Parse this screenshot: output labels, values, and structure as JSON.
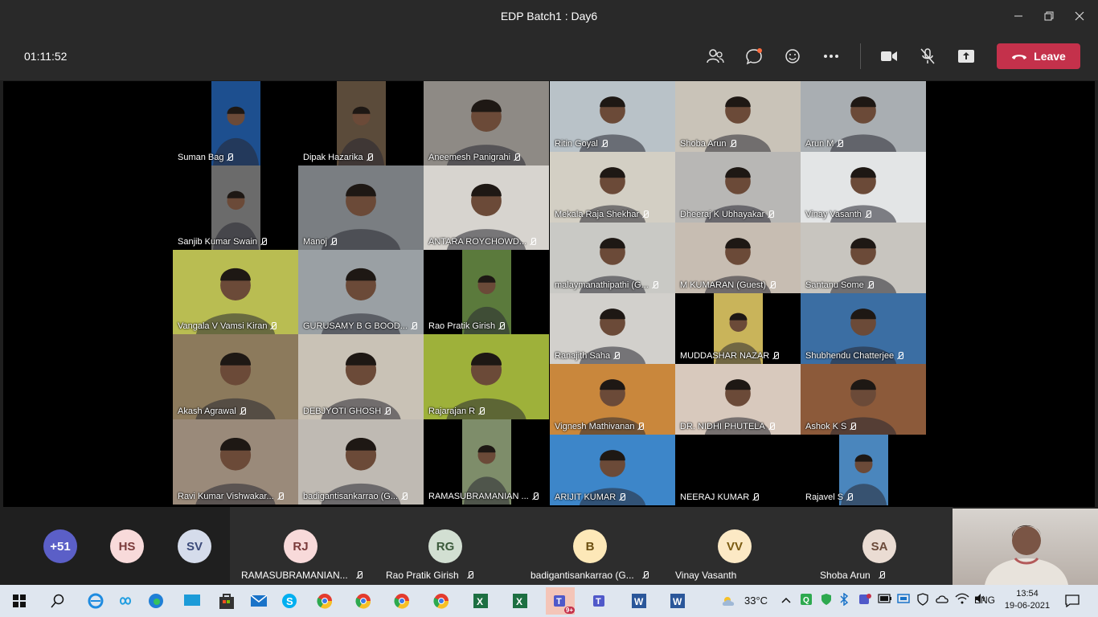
{
  "window": {
    "title": "EDP Batch1 : Day6"
  },
  "toolbar": {
    "timer": "01:11:52",
    "leave_label": "Leave"
  },
  "tiles": [
    {
      "name": "Suman Bag",
      "bg": "#1d4f8f"
    },
    {
      "name": "Dipak Hazarika",
      "bg": "#5b4b3a"
    },
    {
      "name": "Aneemesh Panigrahi",
      "bg": "#8e8a85"
    },
    {
      "name": "Ritin Goyal",
      "bg": "#b9c2c8"
    },
    {
      "name": "Shoba Arun",
      "bg": "#c9c3b8"
    },
    {
      "name": "Arun M",
      "bg": "#a9aeb2"
    },
    {
      "name": "Sanjib Kumar Swain",
      "bg": "#6b6b6b"
    },
    {
      "name": "Manoj",
      "bg": "#7a7e82"
    },
    {
      "name": "ANTARA ROYCHOWD...",
      "bg": "#d7d4cf"
    },
    {
      "name": "Mekala Raja Shekhar",
      "bg": "#d3cfc4"
    },
    {
      "name": "Dheeraj K Ubhayakar",
      "bg": "#b8b7b5"
    },
    {
      "name": "Vinay Vasanth",
      "bg": "#e3e5e6"
    },
    {
      "name": "Vangala V Vamsi Kiran",
      "bg": "#b9bd52"
    },
    {
      "name": "GURUSAMY B G BOOD...",
      "bg": "#9aa0a4"
    },
    {
      "name": "Rao Pratik Girish",
      "bg": "#5b7a3c"
    },
    {
      "name": "malaymanathipathi (G...",
      "bg": "#c9c9c5"
    },
    {
      "name": "M KUMARAN (Guest)",
      "bg": "#c7bdb2"
    },
    {
      "name": "Santanu Some",
      "bg": "#c8c5bf"
    },
    {
      "name": "Akash Agrawal",
      "bg": "#8c7a5c"
    },
    {
      "name": "DEBJYOTI GHOSH",
      "bg": "#c9c2b6"
    },
    {
      "name": "Rajarajan R",
      "bg": "#9eb13a"
    },
    {
      "name": "Ranajith Saha",
      "bg": "#d2d0cc"
    },
    {
      "name": "MUDDASHAR NAZAR",
      "bg": "#c9b45a"
    },
    {
      "name": "Shubhendu Chatterjee",
      "bg": "#3b6ea3"
    },
    {
      "name": "Ravi Kumar Vishwakar...",
      "bg": "#9a8a7a"
    },
    {
      "name": "badigantisankarrao (G...",
      "bg": "#bfbab3"
    },
    {
      "name": "RAMASUBRAMANIAN ...",
      "bg": "#7e8d6a"
    },
    {
      "name": "Vignesh Mathivanan",
      "bg": "#c9873c"
    },
    {
      "name": "DR. NIDHI  PHUTELA",
      "bg": "#d8c9bd"
    },
    {
      "name": "Ashok K S",
      "bg": "#8c5a3a"
    },
    {
      "name": "ARIJIT KUMAR",
      "bg": "#3d86c9"
    },
    {
      "name": "NEERAJ KUMAR",
      "bg": "#000000"
    },
    {
      "name": "Rajavel S",
      "bg": "#4a86bd"
    }
  ],
  "strip": {
    "overflow": {
      "initials": "+51",
      "color": "#5b5fc7"
    },
    "avatars": [
      {
        "initials": "HS",
        "color": "#f8dada"
      },
      {
        "initials": "SV",
        "color": "#d5dceb"
      }
    ],
    "participants": [
      {
        "initials": "RJ",
        "name": "RAMASUBRAMANIAN...",
        "color": "#f8dada"
      },
      {
        "initials": "RG",
        "name": "Rao Pratik Girish",
        "color": "#d2dfd2"
      },
      {
        "initials": "B",
        "name": "badigantisankarrao (G...",
        "color": "#fde8b8"
      },
      {
        "initials": "VV",
        "name": "Vinay Vasanth",
        "color": "#fce9c5"
      },
      {
        "initials": "SA",
        "name": "Shoba Arun",
        "color": "#eadcd3"
      }
    ]
  },
  "taskbar": {
    "weather": "33°C",
    "lang": "ENG",
    "time": "13:54",
    "date": "19-06-2021",
    "teams_badge": "9+"
  }
}
